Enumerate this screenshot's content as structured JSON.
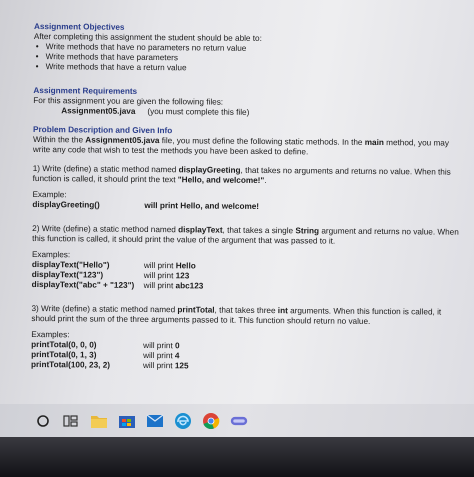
{
  "objectives": {
    "heading": "Assignment Objectives",
    "intro": "After completing this assignment the student should be able to:",
    "items": [
      "Write methods that have no parameters no return value",
      "Write methods that have parameters",
      "Write methods that have a return value"
    ]
  },
  "requirements": {
    "heading": "Assignment Requirements",
    "intro": "For this assignment you are given the following files:",
    "file": "Assignment05.java",
    "file_note": "(you must complete this file)"
  },
  "problem": {
    "heading": "Problem Description and Given Info",
    "p1_a": "Within the the ",
    "p1_file": "Assignment05.java",
    "p1_b": " file, you must define the following static methods. In the ",
    "p1_main": "main",
    "p1_c": " method, you may write any code that wish to test the methods you have been asked to define."
  },
  "task1": {
    "a": "1) Write (define) a static method named ",
    "name": "displayGreeting",
    "b": ", that takes no arguments and returns no value. When this function is called, it should print the text ",
    "text": "\"Hello, and welcome!\"",
    "c": ".",
    "example_label": "Example:",
    "example_code": "displayGreeting()",
    "example_result": "will print Hello, and welcome!"
  },
  "task2": {
    "a": "2) Write (define) a static method named ",
    "name": "displayText",
    "b": ", that takes a single ",
    "type": "String",
    "c": " argument and returns no value. When this function is called, it should print the value of the argument that was passed to it.",
    "examples_label": "Examples:",
    "examples": [
      {
        "code": "displayText(\"Hello\")",
        "pre": "will print ",
        "out": "Hello"
      },
      {
        "code": "displayText(\"123\")",
        "pre": "will print ",
        "out": "123"
      },
      {
        "code": "displayText(\"abc\" + \"123\")",
        "pre": "will print ",
        "out": "abc123"
      }
    ]
  },
  "task3": {
    "a": "3) Write (define) a static method named ",
    "name": "printTotal",
    "b": ", that takes three ",
    "type": "int",
    "c": " arguments. When this function is called, it should print the sum of the three arguments passed to it. This function should return no value.",
    "examples_label": "Examples:",
    "examples": [
      {
        "code": "printTotal(0, 0, 0)",
        "pre": "will print ",
        "out": "0"
      },
      {
        "code": "printTotal(0, 1, 3)",
        "pre": "will print ",
        "out": "4"
      },
      {
        "code": "printTotal(100, 23, 2)",
        "pre": "will print ",
        "out": "125"
      }
    ]
  },
  "taskbar": {
    "icons": [
      "search-icon",
      "task-view-icon",
      "file-explorer-icon",
      "store-icon",
      "mail-icon",
      "edge-icon",
      "chrome-icon",
      "app-icon"
    ]
  }
}
